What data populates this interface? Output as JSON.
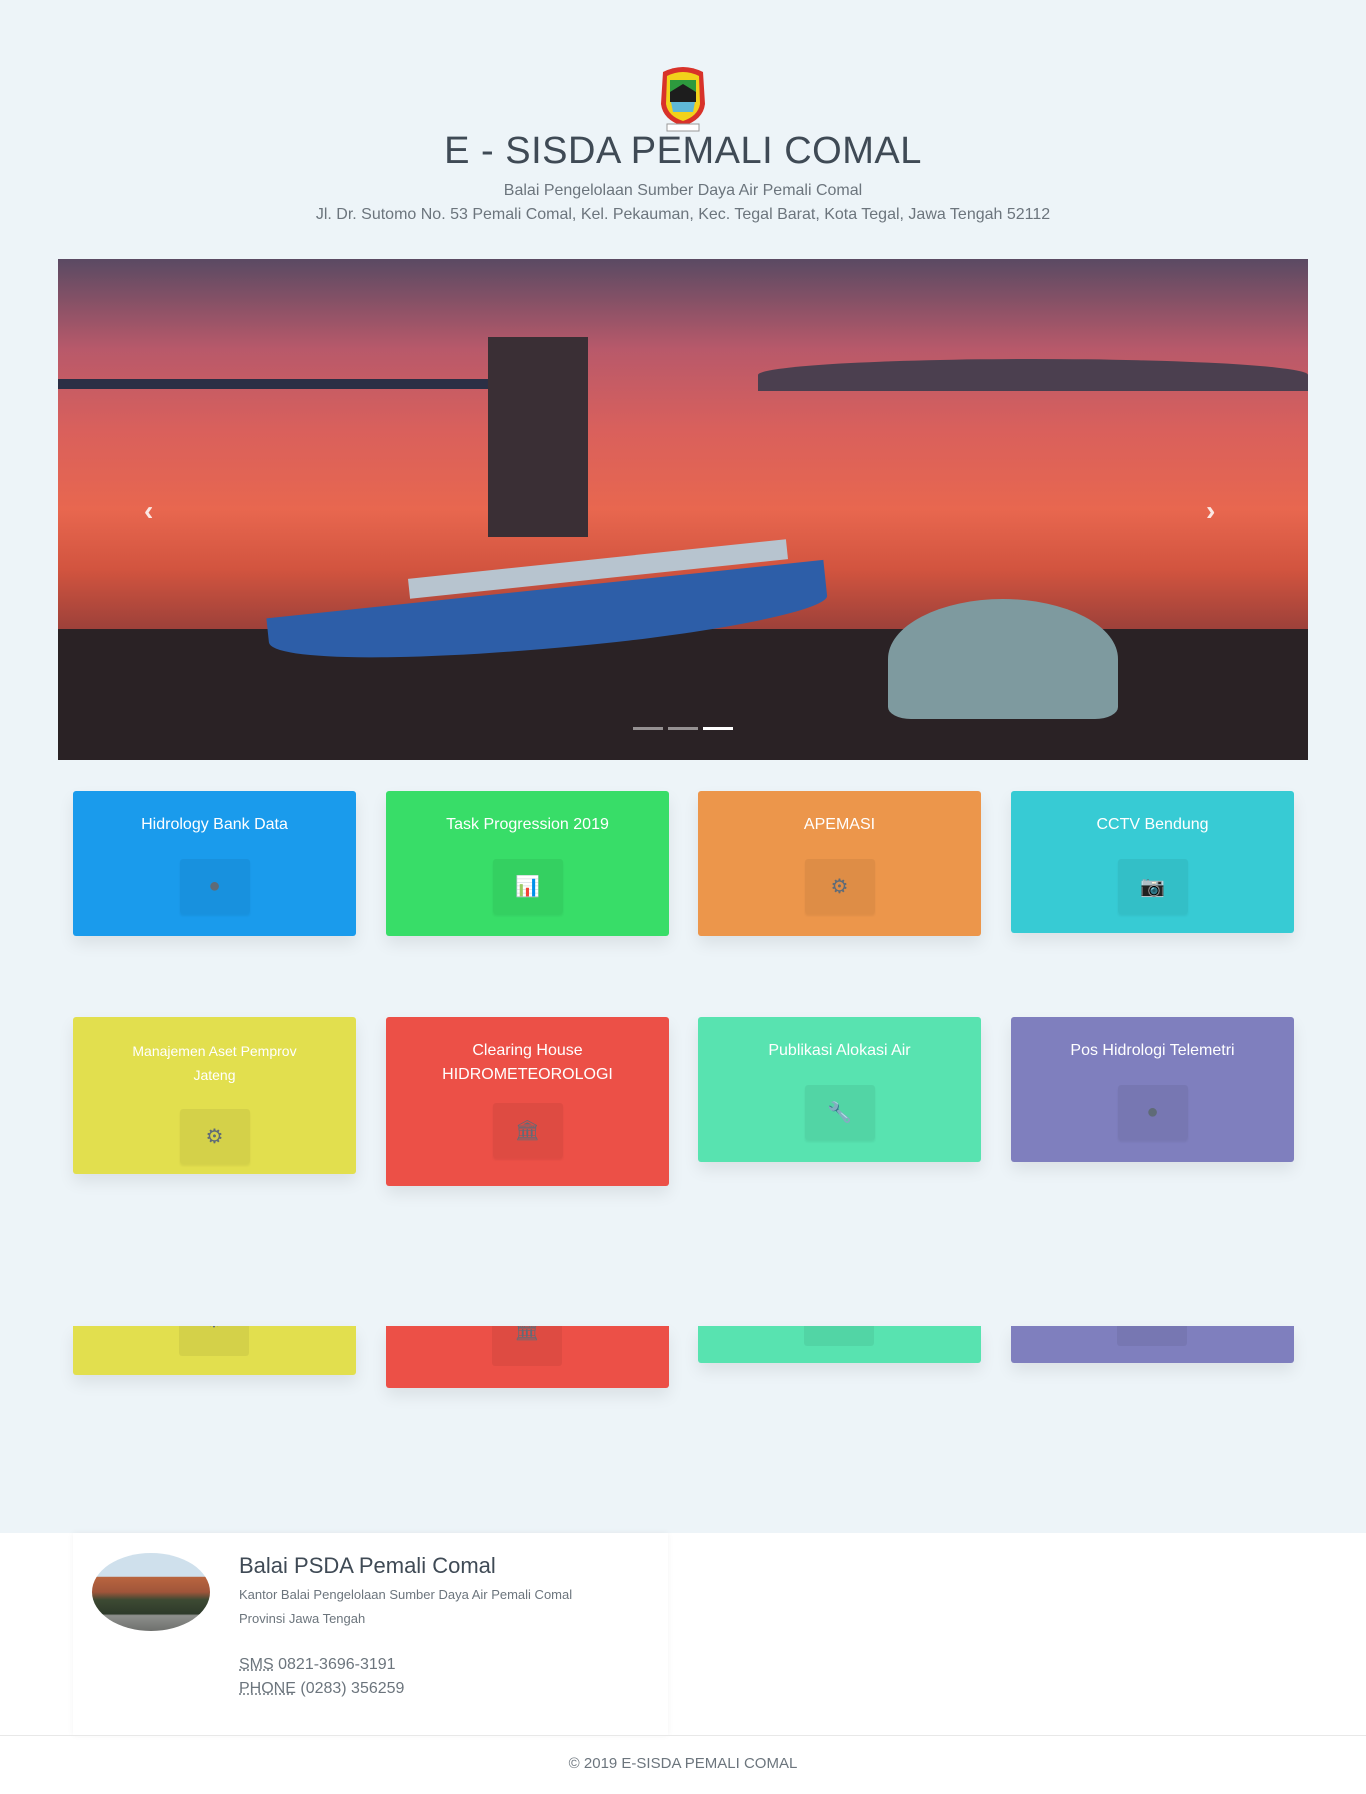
{
  "header": {
    "title": "E - SISDA PEMALI COMAL",
    "subtitle": "Balai Pengelolaan Sumber Daya Air Pemali Comal",
    "address": "Jl. Dr. Sutomo No. 53 Pemali Comal, Kel. Pekauman, Kec. Tegal Barat, Kota Tegal, Jawa Tengah 52112"
  },
  "slider": {
    "prev": "‹",
    "next": "›",
    "indicators": 3,
    "active": 3
  },
  "cards": [
    {
      "label": "Hidrology Bank Data",
      "icon": "tint-icon",
      "glyph": "●",
      "color": "#1a9bec"
    },
    {
      "label": "Task Progression 2019",
      "icon": "bar-chart-icon",
      "glyph": "📊",
      "color": "#38dd68"
    },
    {
      "label": "APEMASI",
      "icon": "gears-icon",
      "glyph": "⚙",
      "color": "#ec964b"
    },
    {
      "label": "CCTV Bendung",
      "icon": "camera-icon",
      "glyph": "📷",
      "color": "#37cbd4"
    },
    {
      "label": "Manajemen Aset Pemprov Jateng",
      "icon": "gear-icon",
      "glyph": "⚙",
      "color": "#e2df4e"
    },
    {
      "label": "Clearing House HIDROMETEOROLOGI",
      "icon": "bank-icon",
      "glyph": "🏛",
      "color": "#ec5047"
    },
    {
      "label": "Publikasi Alokasi Air",
      "icon": "wrench-icon",
      "glyph": "🔧",
      "color": "#58e3b0"
    },
    {
      "label": "Pos Hidrologi Telemetri",
      "icon": "globe-icon",
      "glyph": "●",
      "color": "#7f7fbe"
    }
  ],
  "footer": {
    "name": "Balai PSDA Pemali Comal",
    "desc1": "Kantor Balai Pengelolaan Sumber Daya Air Pemali Comal",
    "desc2": "Provinsi Jawa Tengah",
    "sms_label": "SMS",
    "sms": "0821-3696-3191",
    "phone_label": "PHONE",
    "phone": "(0283) 356259",
    "copyright": "© 2019 E-SISDA PEMALI COMAL"
  }
}
